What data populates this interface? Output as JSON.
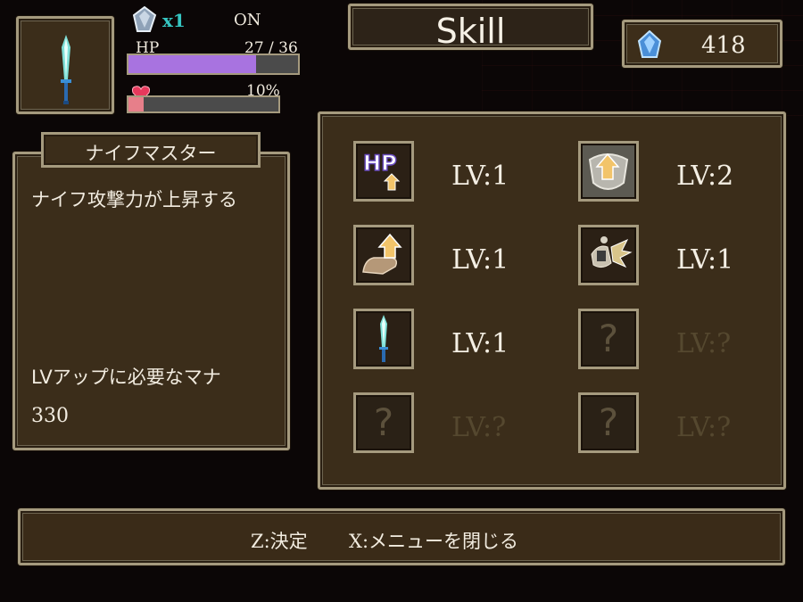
{
  "status": {
    "gem_count": "x1",
    "toggle_state": "ON",
    "hp_label": "HP",
    "hp_value": "27 / 36",
    "hp_current": 27,
    "hp_max": 36,
    "affection_value": "10%",
    "affection_fraction": 0.1,
    "hp_bar_color": "#a873e0",
    "affection_bar_color": "#e77f8a"
  },
  "header": {
    "title": "Skill"
  },
  "currency": {
    "mana": "418"
  },
  "selected_skill": {
    "name": "ナイフマスター",
    "description": "ナイフ攻撃力が上昇する",
    "requirement_label": "LVアップに必要なマナ",
    "requirement_value": "330"
  },
  "skills": [
    {
      "icon": "hp-up-icon",
      "level": "LV:1",
      "locked": false
    },
    {
      "icon": "shield-up-icon",
      "level": "LV:2",
      "locked": false
    },
    {
      "icon": "hand-up-icon",
      "level": "LV:1",
      "locked": false
    },
    {
      "icon": "claw-attack-icon",
      "level": "LV:1",
      "locked": false
    },
    {
      "icon": "knife-icon",
      "level": "LV:1",
      "locked": false
    },
    {
      "icon": "question-icon",
      "level": "LV:?",
      "locked": true,
      "mark": "?"
    },
    {
      "icon": "question-icon",
      "level": "LV:?",
      "locked": true,
      "mark": "?"
    },
    {
      "icon": "question-icon",
      "level": "LV:?",
      "locked": true,
      "mark": "?"
    }
  ],
  "footer": {
    "confirm": "Z:決定",
    "close": "X:メニューを閉じる"
  },
  "colors": {
    "panel": "#3b2d1a",
    "border": "#a59a7e",
    "gem_text": "#36c6c2",
    "locked_text": "#55482f"
  }
}
